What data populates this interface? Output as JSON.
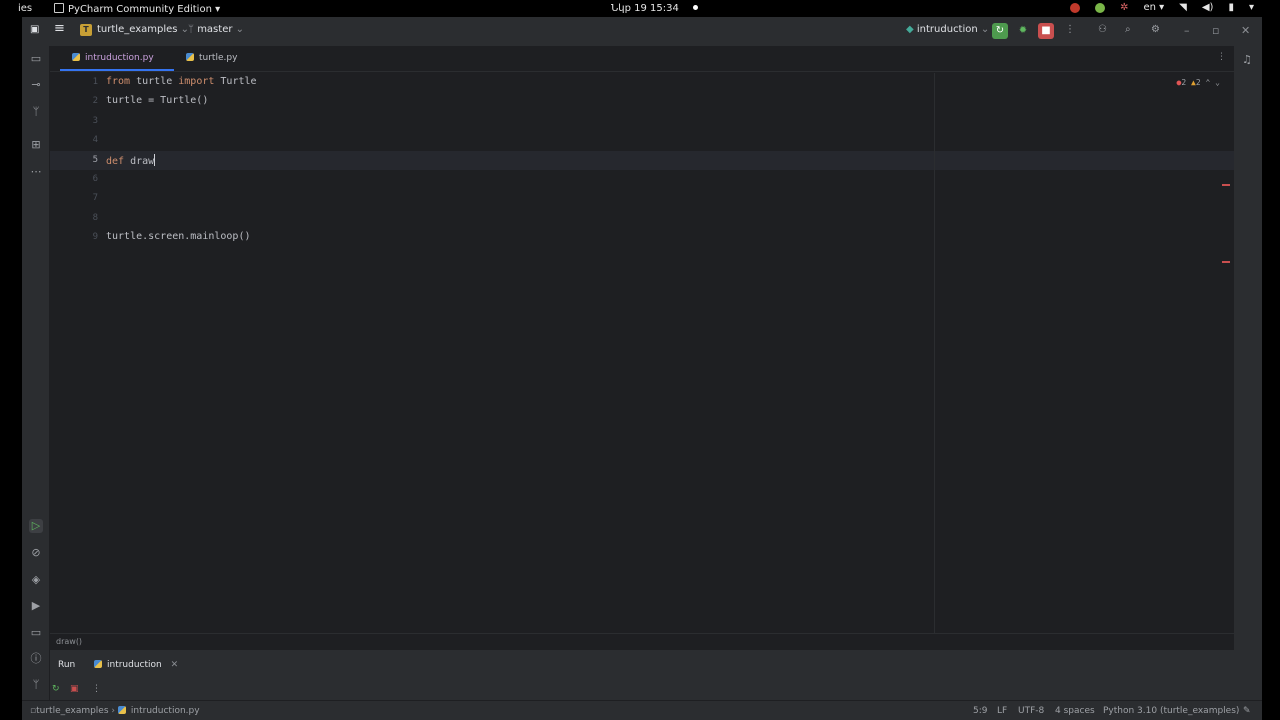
{
  "system": {
    "activities": "ies",
    "app_menu": "PyCharm Community Edition ▾",
    "clock": "Նկp 19  15:34",
    "lang": "en ▾"
  },
  "titlebar": {
    "project_badge": "T",
    "project": "turtle_examples",
    "branch": "master",
    "run_config": "intruduction"
  },
  "tabs": [
    {
      "label": "intruduction.py",
      "active": true
    },
    {
      "label": "turtle.py",
      "active": false
    }
  ],
  "editor": {
    "lines": [
      {
        "num": "1",
        "tokens": [
          {
            "k": "kw",
            "t": "from"
          },
          {
            "k": "",
            "t": " turtle "
          },
          {
            "k": "kw",
            "t": "import"
          },
          {
            "k": "",
            "t": " Turtle"
          }
        ]
      },
      {
        "num": "2",
        "tokens": [
          {
            "k": "",
            "t": "turtle = Turtle()"
          }
        ]
      },
      {
        "num": "3",
        "tokens": []
      },
      {
        "num": "4",
        "tokens": []
      },
      {
        "num": "5",
        "tokens": [
          {
            "k": "kw",
            "t": "def"
          },
          {
            "k": "",
            "t": " draw"
          }
        ],
        "current": true
      },
      {
        "num": "6",
        "tokens": []
      },
      {
        "num": "7",
        "tokens": []
      },
      {
        "num": "8",
        "tokens": []
      },
      {
        "num": "9",
        "tokens": [
          {
            "k": "",
            "t": "turtle.screen.mainloop()"
          }
        ]
      }
    ],
    "errors": "2",
    "warnings": "2"
  },
  "breadcrumb_bottom": "draw()",
  "run_panel": {
    "label": "Run",
    "tab": "intruduction"
  },
  "statusbar": {
    "path_project": "turtle_examples",
    "path_file": "intruduction.py",
    "position": "5:9",
    "line_sep": "LF",
    "encoding": "UTF-8",
    "indent": "4 spaces",
    "interpreter": "Python 3.10 (turtle_examples)"
  }
}
